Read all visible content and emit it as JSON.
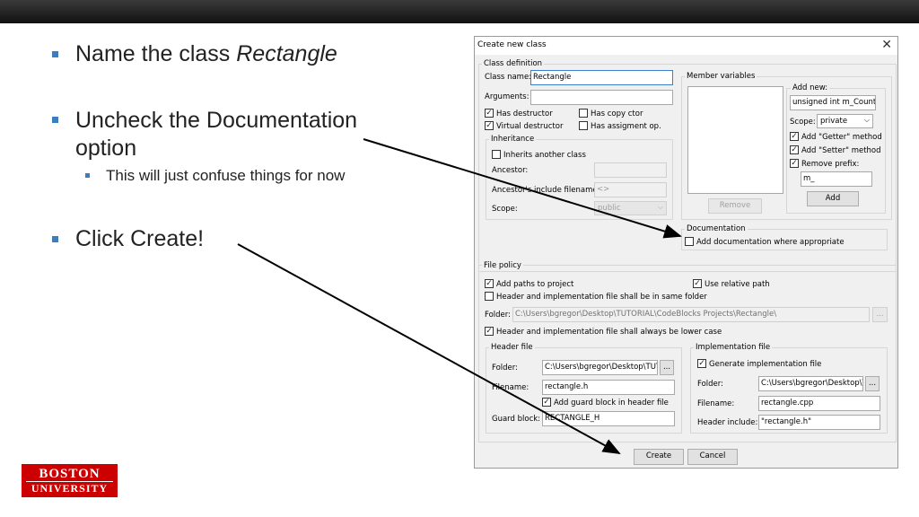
{
  "slide": {
    "bullets": [
      {
        "prefix": "Name the class ",
        "emph": "Rectangle"
      },
      {
        "line1": "Uncheck the Documentation",
        "line2": "option"
      },
      {
        "sub": "This will just confuse things for now"
      },
      {
        "text": "Click Create!"
      }
    ],
    "logo": {
      "line1": "BOSTON",
      "line2": "UNIVERSITY"
    }
  },
  "dialog": {
    "title": "Create new class",
    "close": "✕",
    "class_def": {
      "group_label": "Class definition",
      "class_name_label": "Class name:",
      "class_name_value": "Rectangle",
      "arguments_label": "Arguments:",
      "arguments_value": "",
      "has_destructor": "Has destructor",
      "virtual_destructor": "Virtual destructor",
      "has_copy_ctor": "Has copy ctor",
      "has_assign_op": "Has assigment op.",
      "inheritance_label": "Inheritance",
      "inherits_another": "Inherits another class",
      "ancestor_label": "Ancestor:",
      "ancestor_include_label": "Ancestor's include filename:",
      "ancestor_include_value": "<>",
      "scope_label": "Scope:",
      "scope_value": "public"
    },
    "members": {
      "group_label": "Member variables",
      "add_new_label": "Add new:",
      "add_new_value": "unsigned int m_Counter",
      "scope_label": "Scope:",
      "scope_value": "private",
      "add_getter": "Add \"Getter\" method",
      "add_setter": "Add \"Setter\" method",
      "remove_prefix": "Remove prefix:",
      "prefix_value": "m_",
      "add_button": "Add",
      "remove_button": "Remove"
    },
    "documentation": {
      "group_label": "Documentation",
      "add_doc": "Add documentation where appropriate"
    },
    "file_policy": {
      "group_label": "File policy",
      "add_paths": "Add paths to project",
      "use_relative": "Use relative path",
      "same_folder": "Header and implementation file shall be in same folder",
      "folder_label": "Folder:",
      "folder_value": "C:\\Users\\bgregor\\Desktop\\TUTORIAL\\CodeBlocks Projects\\Rectangle\\",
      "browse": "...",
      "lower_case": "Header and implementation file shall always be lower case"
    },
    "header_file": {
      "group_label": "Header file",
      "folder_label": "Folder:",
      "folder_value": "C:\\Users\\bgregor\\Desktop\\TUTC",
      "browse": "...",
      "filename_label": "Filename:",
      "filename_value": "rectangle.h",
      "guard_block": "Add guard block in header file",
      "guard_label": "Guard block:",
      "guard_value": "RECTANGLE_H"
    },
    "impl_file": {
      "group_label": "Implementation file",
      "generate": "Generate implementation file",
      "folder_label": "Folder:",
      "folder_value": "C:\\Users\\bgregor\\Desktop\\T",
      "browse": "...",
      "filename_label": "Filename:",
      "filename_value": "rectangle.cpp",
      "header_include_label": "Header include:",
      "header_include_value": "\"rectangle.h\""
    },
    "buttons": {
      "create": "Create",
      "cancel": "Cancel"
    },
    "check_mark": "✓"
  },
  "colors": {
    "bullet": "#3b7dbf",
    "logo_red": "#cc0000",
    "arrow": "#000000"
  }
}
